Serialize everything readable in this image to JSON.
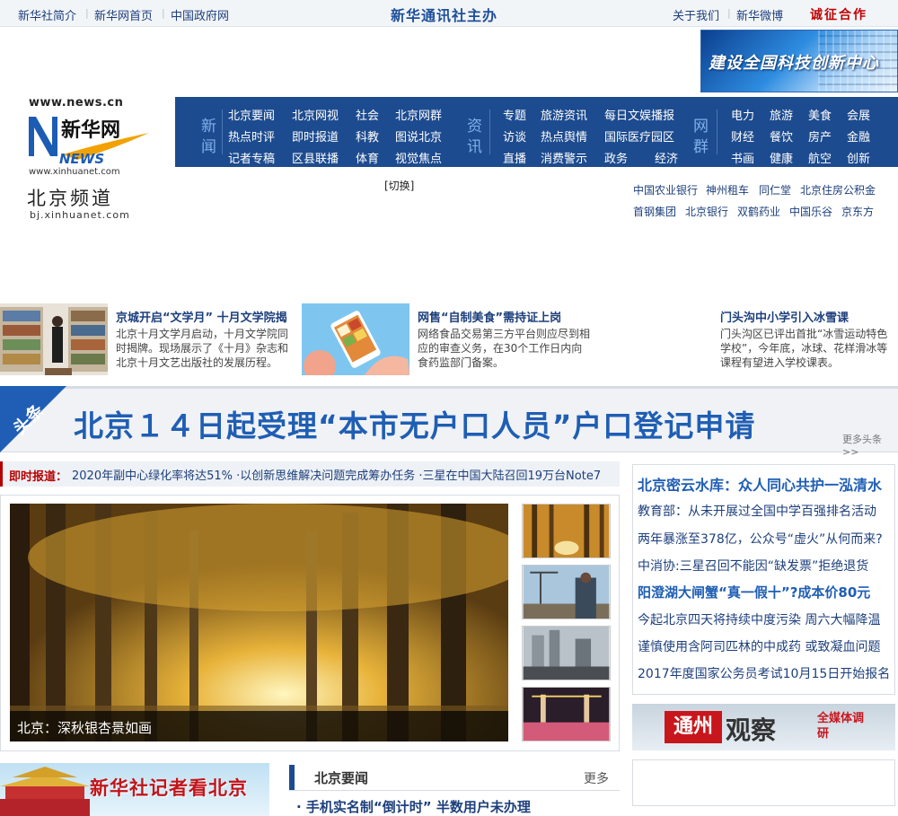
{
  "topbar": {
    "links": [
      "新华社简介",
      "新华网首页",
      "中国政府网"
    ],
    "center": "新华通讯社主办",
    "right_links": [
      "关于我们",
      "新华微博"
    ],
    "cooperation": "诚征合作"
  },
  "banner": {
    "text": "建设全国科技创新中心"
  },
  "logo": {
    "url_top": "www.news.cn",
    "brand": "新华网",
    "brand_sub": "NEWS",
    "url_bottom": "www.xinhuanet.com",
    "channel": "北京频道",
    "channel_url": "bj.xinhuanet.com"
  },
  "nav": {
    "cat_news": "新闻",
    "news_items": [
      "北京要闻",
      "北京网视",
      "社会",
      "北京网群",
      "热点时评",
      "即时报道",
      "科教",
      "图说北京",
      "记者专稿",
      "区县联播",
      "体育",
      "视觉焦点"
    ],
    "cat_info": "资讯",
    "info_items": [
      "专题",
      "旅游资讯",
      "每日文娱播报",
      "访谈",
      "热点舆情",
      "国际医疗园区",
      "直播",
      "消费警示",
      "政务",
      "经济"
    ],
    "cat_group": "网群",
    "group_items": [
      "电力",
      "旅游",
      "美食",
      "会展",
      "财经",
      "餐饮",
      "房产",
      "金融",
      "书画",
      "健康",
      "航空",
      "创新"
    ]
  },
  "switch": "[切换]",
  "partners": [
    "中国农业银行",
    "神州租车",
    "同仁堂",
    "北京住房公积金",
    "首钢集团",
    "北京银行",
    "双鹤药业",
    "中国乐谷",
    "京东方"
  ],
  "stories": [
    {
      "title": "京城开启“文学月” 十月文学院揭",
      "desc": "北京十月文学月启动，十月文学院同时揭牌。现场展示了《十月》杂志和北京十月文艺出版社的发展历程。"
    },
    {
      "title": "网售“自制美食”需持证上岗",
      "desc": "网络食品交易第三方平台则应尽到相应的审查义务，在30个工作日内向食药监部门备案。"
    },
    {
      "title": "门头沟中小学引入冰雪课",
      "desc": "门头沟区已评出首批“冰雪运动特色学校”，今年底，冰球、花样滑冰等课程有望进入学校课表。"
    }
  ],
  "headline": {
    "tag": "头条",
    "text": "北京１４日起受理“本市无户口人员”户口登记申请",
    "more": "更多头条>>"
  },
  "ticker": {
    "label": "即时报道：",
    "items": "2020年副中心绿化率将达51%   ·以创新思维解决问题完成筹办任务   ·三星在中国大陆召回19万台Note7"
  },
  "focus": {
    "caption": "北京：深秋银杏景如画"
  },
  "right": {
    "title": "北京密云水库：众人同心共护一泓清水",
    "links": [
      "教育部：从未开展过全国中学百强排名活动",
      "两年暴涨至378亿，公众号“虚火”从何而来?",
      "中消协:三星召回不能因“缺发票”拒绝退货",
      "阳澄湖大闸蟹“真一假十”?成本价80元",
      "今起北京四天将持续中度污染  周六大幅降温",
      "谨慎使用含阿司匹林的中成药  或致凝血问题",
      "2017年度国家公务员考试10月15日开始报名"
    ],
    "tongzhou_left": "通州",
    "tongzhou_mid": "观察",
    "tongzhou_right": "全媒体调研"
  },
  "reporter": {
    "text": "新华社记者看北京"
  },
  "bjnews": {
    "title": "北京要闻",
    "more": "更多",
    "first": "· 手机实名制“倒计时” 半数用户未办理"
  },
  "colors": {
    "nav_bg": "#1d4b8f",
    "headline_blue": "#1f5eb4",
    "ticker_red": "#b50000",
    "link": "#1d3f7c"
  }
}
